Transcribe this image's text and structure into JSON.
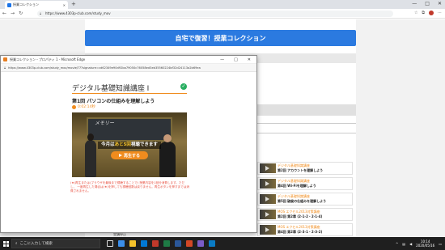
{
  "background_browser": {
    "tab_title": "授業コレクション",
    "new_tab": "+",
    "url": "https://www.4303p-club.com/study_mov",
    "window_controls": [
      "—",
      "□",
      "✕"
    ],
    "banner": "自宅で復習！授業コレクション",
    "lessons": [
      {
        "series": "デジタル基礎知識講座",
        "title": "第2回 アカウントを理解しよう"
      },
      {
        "series": "デジタル基礎知識講座",
        "title": "第4回 Wi-Fiを理解しよう"
      },
      {
        "series": "デジタル基礎知識講座",
        "title": "第5回 破綻の仕組みを理解しよう"
      },
      {
        "series": "MOS エクセル2013対策講座",
        "title": "第2回 第2章 (2-1-2・2-1-4)"
      },
      {
        "series": "MOS エクセル2013対策講座",
        "title": "第4回 第2章 (2-3-1・2-3-2)"
      }
    ],
    "bottom_label": "受講停止"
  },
  "popup": {
    "window_title": "授業コレクション・プロパティ 1 - Microsoft Edge",
    "window_controls": [
      "—",
      "□",
      "✕"
    ],
    "url": "https://www.4303p-club.com/study_mov/movie/?7?signature=cd62349e90d92ba79050c76058ed3eb35560224bf32d24113a2b69ea",
    "course_title": "デジタル基礎知識講座 Ⅰ",
    "lesson_heading": "第1回 パソコンの仕組みを理解しよう",
    "duration": "0:02:14秒",
    "video": {
      "board_text": "メモリー",
      "overlay_prefix": "今月は",
      "overlay_highlight": "あと5回",
      "overlay_suffix": "視聴できます",
      "play_label": "再生する"
    },
    "notice": "(★)再生または(ブラウザを最後まで視聴することで) 授業内容を1回分消費します。ただし、 一度再生した場合は(★)を押しても視聴回数は戻りません。再生ボタンを押すまでは消費されません。"
  },
  "taskbar": {
    "search_placeholder": "ここに入力して検索",
    "time": "10:14",
    "date": "2020/05/16"
  }
}
